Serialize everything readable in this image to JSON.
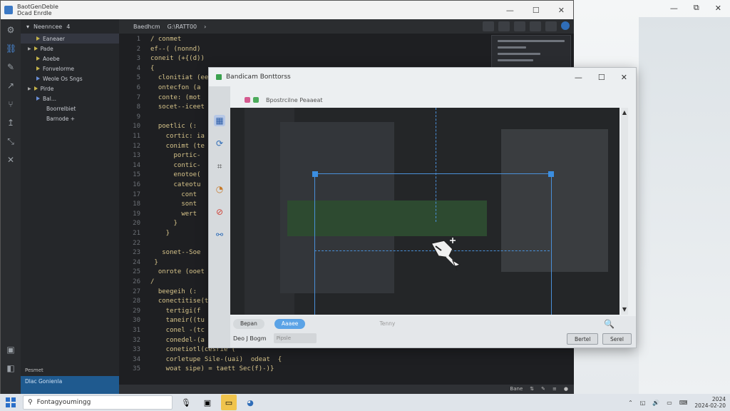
{
  "ide": {
    "title_line1": "BaotGenDeble",
    "title_line2": "Dcad Enrdle",
    "window_controls": [
      "—",
      "☐",
      "✕"
    ]
  },
  "desktop": {
    "window_controls": [
      "—",
      "⧉",
      "✕"
    ]
  },
  "sidebar": {
    "header": "Neenncee",
    "header_count": "4",
    "items": [
      {
        "label": "Eaneaer"
      },
      {
        "label": "Pade"
      },
      {
        "label": "Aoebe"
      },
      {
        "label": "Fonvelorme"
      },
      {
        "label": "Weole Os Sngs"
      },
      {
        "label": "Pirde"
      },
      {
        "label": "Bal..."
      },
      {
        "label": "Boorrelbiet"
      },
      {
        "label": "Barnode +"
      }
    ],
    "bottom_label": "Pesmet",
    "status_text": "Dlac Gonienla"
  },
  "editor": {
    "tab_label": "Baedhcm",
    "tab_file": "G:\\RATT00",
    "lines": [
      {
        "n": "1",
        "t": "/ conmet"
      },
      {
        "n": "2",
        "t": "ef--( (nonnd)"
      },
      {
        "n": "3",
        "t": "coneit (+{(d))"
      },
      {
        "n": "4",
        "t": "{"
      },
      {
        "n": "5",
        "t": "  clonitiat (ee"
      },
      {
        "n": "6",
        "t": "  ontecfon (a"
      },
      {
        "n": "7",
        "t": "  conte: (mot"
      },
      {
        "n": "8",
        "t": "  socet--iceet"
      },
      {
        "n": "9",
        "t": ""
      },
      {
        "n": "10",
        "t": "  poetlic (:"
      },
      {
        "n": "11",
        "t": "    cortic: ia"
      },
      {
        "n": "12",
        "t": "    conimt (te"
      },
      {
        "n": "13",
        "t": "      portic-"
      },
      {
        "n": "14",
        "t": "      contic-"
      },
      {
        "n": "15",
        "t": "      enotoe("
      },
      {
        "n": "16",
        "t": "      cateotu"
      },
      {
        "n": "17",
        "t": "        cont"
      },
      {
        "n": "18",
        "t": "        sont"
      },
      {
        "n": "19",
        "t": "        wert"
      },
      {
        "n": "20",
        "t": "      }"
      },
      {
        "n": "21",
        "t": "    }"
      },
      {
        "n": "22",
        "t": ""
      },
      {
        "n": "23",
        "t": "   sonet--Soe"
      },
      {
        "n": "24",
        "t": " }"
      },
      {
        "n": "25",
        "t": "  onrote (ooet"
      },
      {
        "n": "26",
        "t": "/"
      },
      {
        "n": "27",
        "t": "  beegeih (:"
      },
      {
        "n": "28",
        "t": "  conectitise(ta"
      },
      {
        "n": "29",
        "t": "    tertigi(f"
      },
      {
        "n": "30",
        "t": "    taneir((tu"
      },
      {
        "n": "31",
        "t": "    conel -(tc"
      },
      {
        "n": "32",
        "t": "    conedel-(a"
      },
      {
        "n": "33",
        "t": "    conetiotl(cesrie ("
      },
      {
        "n": "34",
        "t": "    corletupe Sile-(uai)  odeat  {"
      },
      {
        "n": "35",
        "t": "    woat sipe) = taett Sec(f)-)}"
      }
    ],
    "status_right": [
      "Bane",
      "⇅",
      "✎",
      "≡",
      "●"
    ]
  },
  "dialog": {
    "title": "Bandicam Bonttorss",
    "toolbar_label": "Bpostrcilne Peaaeat",
    "tabs": [
      "Bepan",
      "Aaaee",
      "Tenny"
    ],
    "bottom_label": "Deo J Bogm",
    "bottom_field": "Pipsle",
    "btn_primary": "Bertel",
    "btn_secondary": "Serel",
    "window_controls": [
      "—",
      "☐",
      "✕"
    ]
  },
  "taskbar": {
    "search_placeholder": "Fontagyoumingg",
    "clock_time": "2024",
    "clock_date": "2024-02-20"
  },
  "colors": {
    "accent": "#3b8ee0",
    "taskbar": "#dfe4ea",
    "ide_bg": "#1e1f22"
  }
}
